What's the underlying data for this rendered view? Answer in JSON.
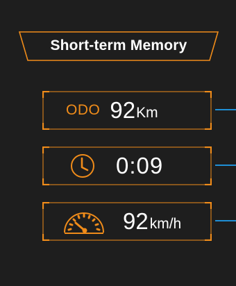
{
  "title": "Short-term Memory",
  "colors": {
    "accent": "#f08c1a",
    "connector": "#1f8fd6",
    "background": "#1e1e1e",
    "text": "#ffffff"
  },
  "odometer": {
    "label": "ODO",
    "value": "92",
    "unit": "Km"
  },
  "trip_time": {
    "icon": "clock-icon",
    "value": "0:09"
  },
  "speed": {
    "icon": "speedometer-icon",
    "value": "92",
    "unit": "km/h"
  }
}
